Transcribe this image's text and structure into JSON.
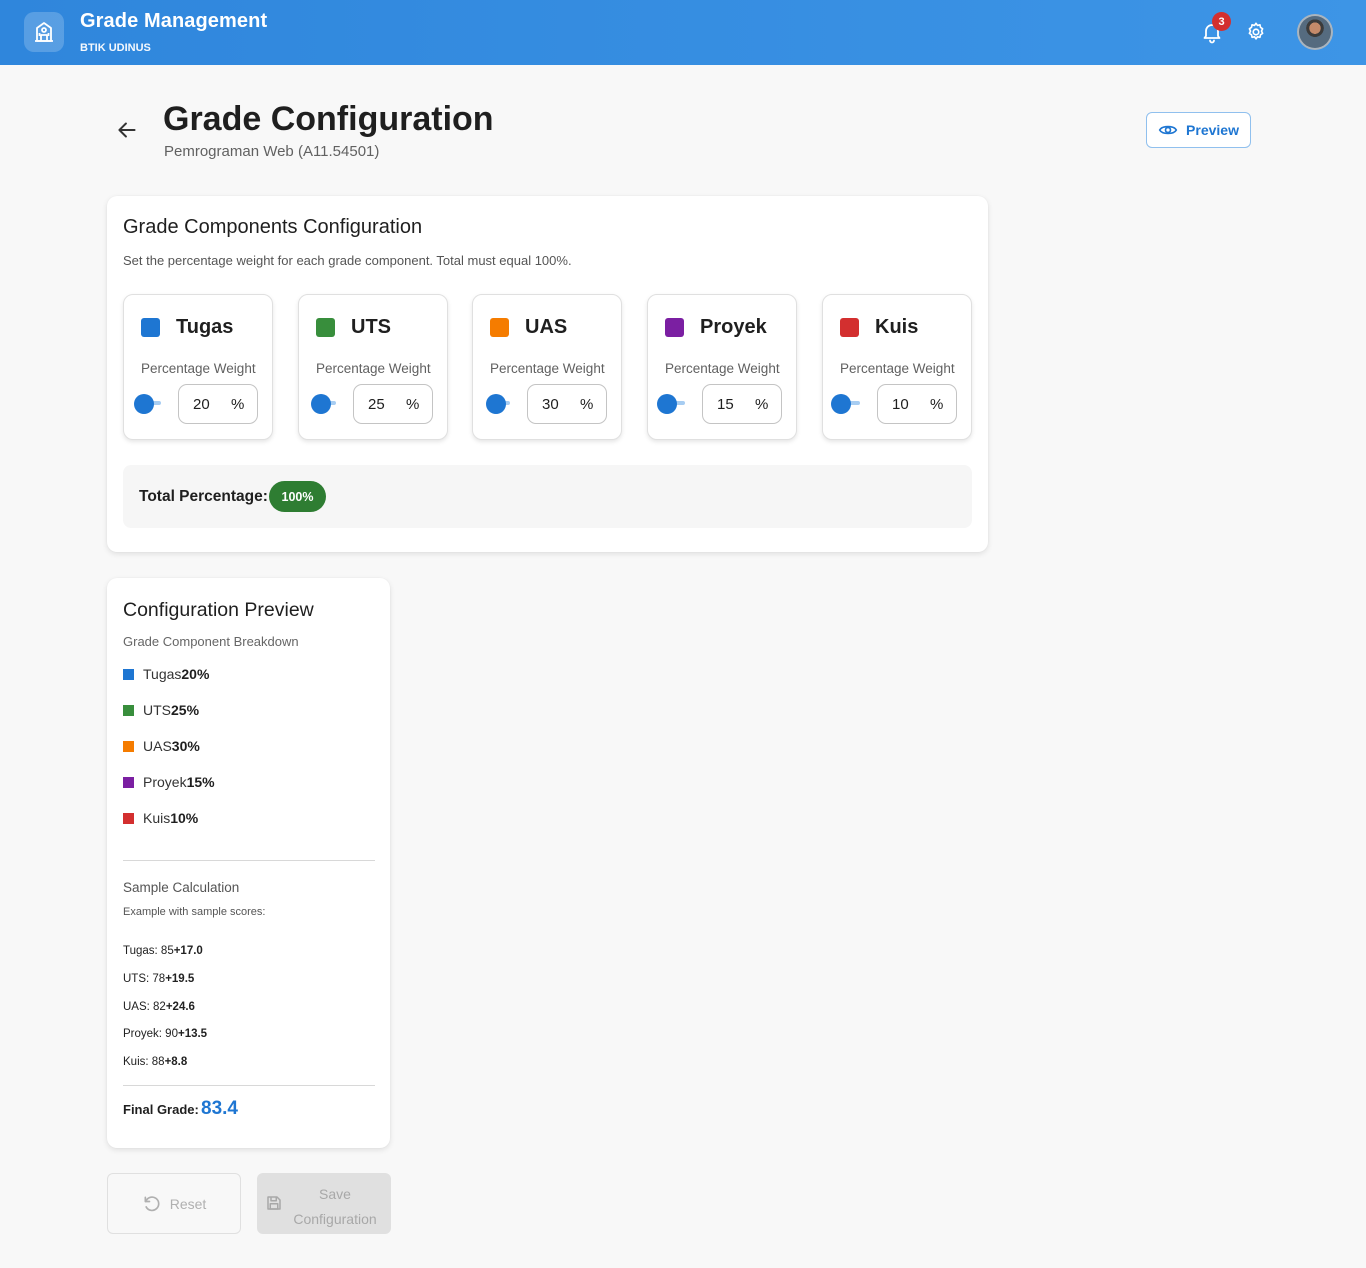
{
  "header": {
    "title": "Grade Management",
    "subtitle": "BTIK UDINUS",
    "notification_count": "3"
  },
  "page": {
    "title": "Grade Configuration",
    "subtitle": "Pemrograman Web (A11.54501)",
    "preview_label": "Preview"
  },
  "config": {
    "title": "Grade Components Configuration",
    "description": "Set the percentage weight for each grade component. Total must equal 100%.",
    "weight_label": "Percentage Weight",
    "unit": "%",
    "components": [
      {
        "name": "Tugas",
        "value": "20",
        "color": "#1e76d2"
      },
      {
        "name": "UTS",
        "value": "25",
        "color": "#388e3c"
      },
      {
        "name": "UAS",
        "value": "30",
        "color": "#f57c00"
      },
      {
        "name": "Proyek",
        "value": "15",
        "color": "#7b1fa2"
      },
      {
        "name": "Kuis",
        "value": "10",
        "color": "#d32f2f"
      }
    ],
    "total_label": "Total Percentage:",
    "total_value": "100%",
    "total_color": "#2e7d32"
  },
  "preview": {
    "title": "Configuration Preview",
    "breakdown_title": "Grade Component Breakdown",
    "breakdown": [
      {
        "name": "Tugas",
        "value": "20%"
      },
      {
        "name": "UTS",
        "value": "25%"
      },
      {
        "name": "UAS",
        "value": "30%"
      },
      {
        "name": "Proyek",
        "value": "15%"
      },
      {
        "name": "Kuis",
        "value": "10%"
      }
    ],
    "sample_title": "Sample Calculation",
    "sample_desc": "Example with sample scores:",
    "samples": [
      {
        "label": "Tugas: 85",
        "result": "+17.0"
      },
      {
        "label": "UTS: 78",
        "result": "+19.5"
      },
      {
        "label": "UAS: 82",
        "result": "+24.6"
      },
      {
        "label": "Proyek: 90",
        "result": "+13.5"
      },
      {
        "label": "Kuis: 88",
        "result": "+8.8"
      }
    ],
    "final_label": "Final Grade:",
    "final_value": "83.4"
  },
  "actions": {
    "reset_label": "Reset",
    "save_label": "Save Configuration"
  },
  "icons": {
    "logo": "school-building-icon",
    "notifications": "bell-icon",
    "settings": "gear-icon",
    "back": "arrow-left-icon",
    "preview": "eye-icon",
    "reset": "undo-icon",
    "save": "floppy-disk-icon"
  }
}
